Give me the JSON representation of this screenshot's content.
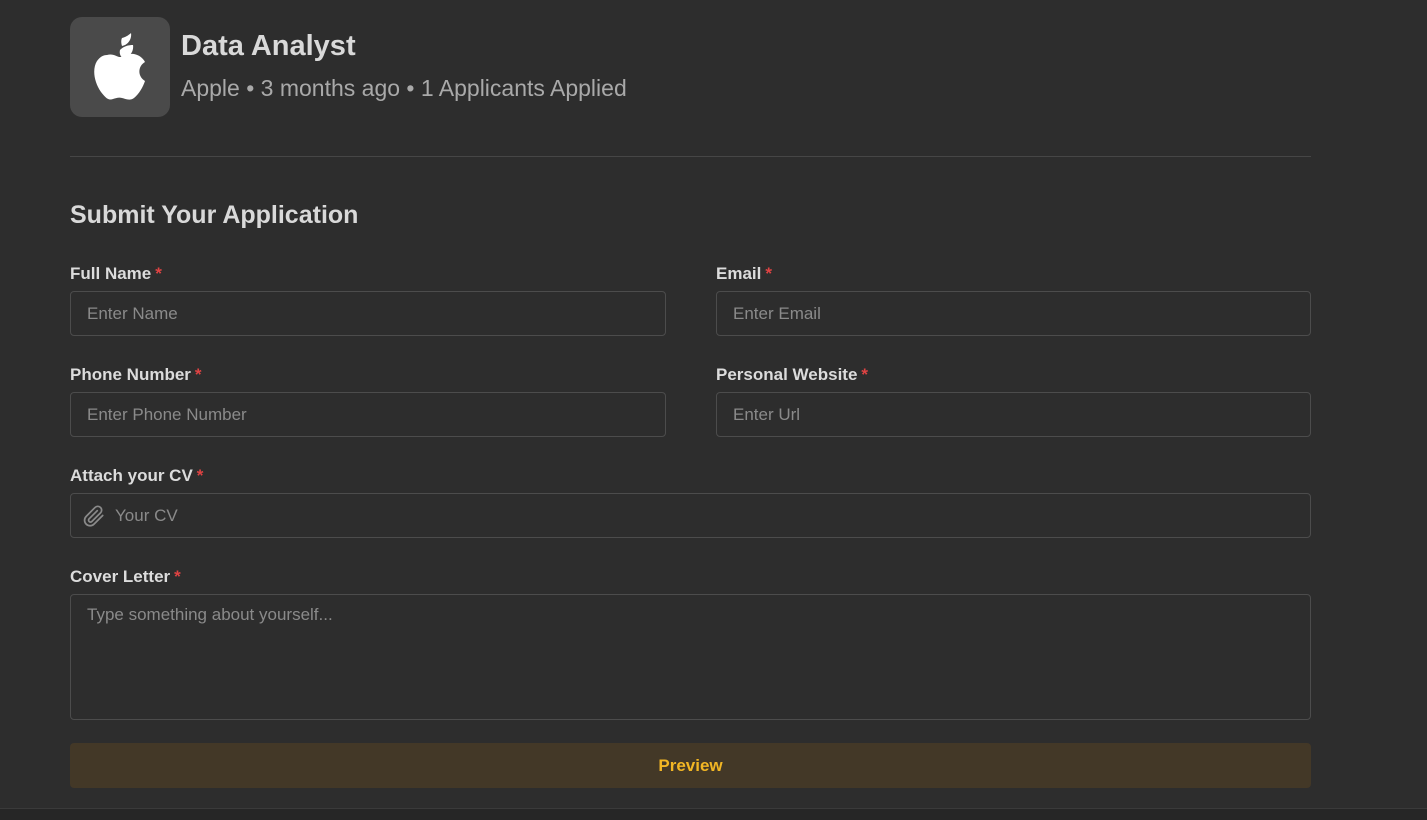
{
  "job": {
    "logo_icon": "apple-logo-icon",
    "title": "Data Analyst",
    "meta": "Apple • 3 months ago • 1 Applicants Applied"
  },
  "form": {
    "section_title": "Submit Your Application",
    "required_mark": "*",
    "full_name": {
      "label": "Full Name",
      "placeholder": "Enter Name",
      "value": ""
    },
    "email": {
      "label": "Email",
      "placeholder": "Enter Email",
      "value": ""
    },
    "phone": {
      "label": "Phone Number",
      "placeholder": "Enter Phone Number",
      "value": ""
    },
    "website": {
      "label": "Personal Website",
      "placeholder": "Enter Url",
      "value": ""
    },
    "cv": {
      "label": "Attach your CV",
      "placeholder": "Your CV",
      "icon": "paperclip-icon"
    },
    "cover_letter": {
      "label": "Cover Letter",
      "placeholder": "Type something about yourself...",
      "value": ""
    },
    "preview_label": "Preview"
  },
  "colors": {
    "background": "#2d2d2d",
    "required": "#e04343",
    "accent": "#f2b624",
    "button_bg": "#433827"
  }
}
